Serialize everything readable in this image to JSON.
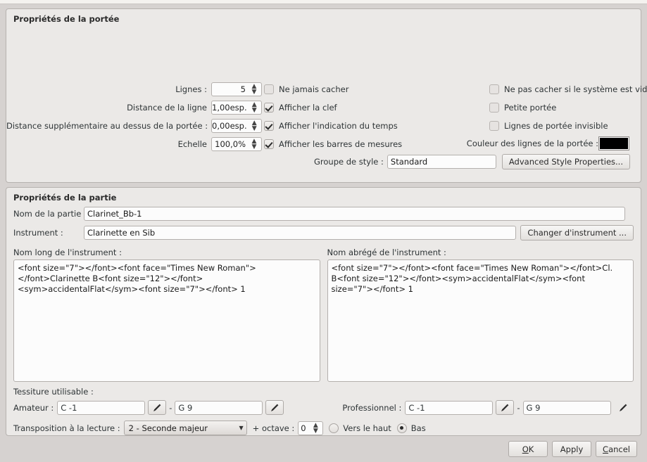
{
  "staff": {
    "title": "Propriétés de la portée",
    "fields": [
      {
        "label": "Lignes :",
        "value": "5"
      },
      {
        "label": "Distance de la ligne",
        "value": "1,00esp."
      },
      {
        "label": "Distance supplémentaire au dessus de la portée :",
        "value": "0,00esp."
      },
      {
        "label": "Echelle",
        "value": "100,0%"
      }
    ],
    "checks_col1": [
      {
        "label": "Ne jamais cacher",
        "checked": false
      },
      {
        "label": "Afficher la clef",
        "checked": true
      },
      {
        "label": "Afficher l'indication du temps",
        "checked": true
      },
      {
        "label": "Afficher les barres de mesures",
        "checked": true
      }
    ],
    "checks_col2": [
      {
        "label": "Ne pas cacher si le système est vide",
        "checked": false
      },
      {
        "label": "Petite portée",
        "checked": false
      },
      {
        "label": "Lignes de portée invisible",
        "checked": false
      }
    ],
    "color_label": "Couleur des lignes de la portée :",
    "color_value": "#000000",
    "style_group_label": "Groupe de style :",
    "style_group_value": "Standard",
    "advanced_button": "Advanced Style Properties..."
  },
  "part": {
    "title": "Propriétés de la partie",
    "part_name_label": "Nom de la partie :",
    "part_name_value": "Clarinet_Bb-1",
    "instrument_label": "Instrument :",
    "instrument_value": "Clarinette en Sib",
    "change_instrument_button": "Changer d'instrument ...",
    "long_name_label": "Nom long de l'instrument :",
    "long_name_value": "<font size=\"7\"></font><font face=\"Times New Roman\"></font>Clarinette B<font size=\"12\"></font><sym>accidentalFlat</sym><font size=\"7\"></font> 1",
    "short_name_label": "Nom abrégé de l'instrument :",
    "short_name_value": "<font size=\"7\"></font><font face=\"Times New Roman\"></font>Cl. B<font size=\"12\"></font><sym>accidentalFlat</sym><font size=\"7\"></font> 1",
    "range_title": "Tessiture utilisable :",
    "amateur_label": "Amateur :",
    "amateur_min": "C -1",
    "amateur_max": "G 9",
    "professional_label": "Professionnel :",
    "professional_min": "C -1",
    "professional_max": "G 9",
    "range_separator": "-",
    "transposition_label": "Transposition à la lecture :",
    "transposition_value": "2 - Seconde majeur",
    "octave_label": "+ octave :",
    "octave_value": "0",
    "direction_up_label": "Vers le haut",
    "direction_down_label": "Bas",
    "direction_up_selected": false,
    "direction_down_selected": true
  },
  "buttons": {
    "ok": "OK",
    "ok_mnemonic": "O",
    "ok_rest": "K",
    "apply": "Apply",
    "cancel": "Cancel",
    "cancel_mnemonic": "C",
    "cancel_rest": "ancel"
  }
}
